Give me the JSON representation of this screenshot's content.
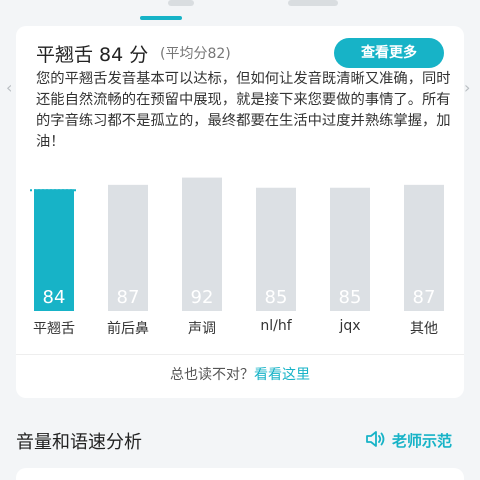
{
  "colors": {
    "accent": "#17b3c7",
    "bar_inactive": "#dce0e4",
    "background": "#f3f5f7"
  },
  "header": {
    "title": "平翘舌 84 分",
    "average": "(平均分82)",
    "more_button": "查看更多"
  },
  "description": "您的平翘舌发音基本可以达标，但如何让发音既清晰又准确，同时还能自然流畅的在预留中展现，就是接下来您要做的事情了。所有的字音练习都不是孤立的，最终都要在生活中过度并熟练掌握，加油！",
  "chart_data": {
    "type": "bar",
    "categories": [
      "平翘舌",
      "前后鼻",
      "声调",
      "nl/hf",
      "jqx",
      "其他"
    ],
    "values": [
      84,
      87,
      92,
      85,
      85,
      87
    ],
    "highlight_index": 0,
    "ylim": [
      0,
      100
    ]
  },
  "hint": {
    "text": "总也读不对？",
    "link": "看看这里"
  },
  "section": {
    "title": "音量和语速分析",
    "teacher_demo": "老师示范"
  },
  "icons": {
    "left": "chevron-left-icon",
    "right": "chevron-right-icon",
    "speaker": "speaker-icon"
  }
}
